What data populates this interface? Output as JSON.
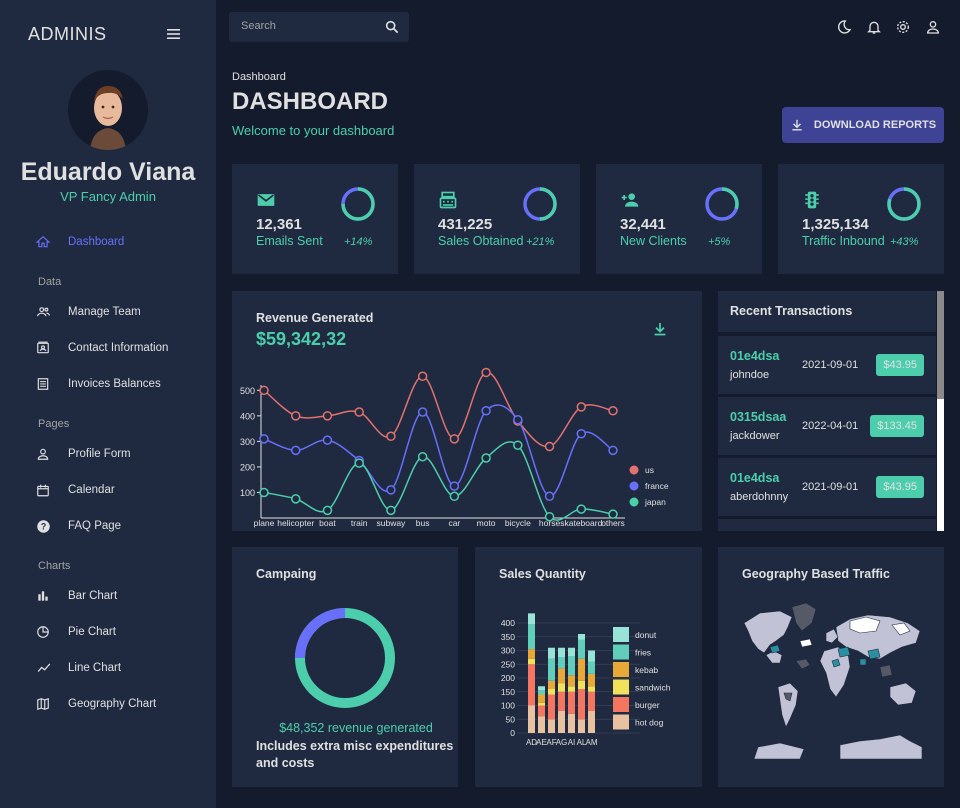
{
  "sidebar": {
    "brand": "ADMINIS",
    "user_name": "Eduardo Viana",
    "user_role": "VP Fancy Admin",
    "items": [
      {
        "label": "Dashboard",
        "icon": "home-icon"
      },
      {
        "label": "Manage Team",
        "icon": "team-icon"
      },
      {
        "label": "Contact Information",
        "icon": "contacts-icon"
      },
      {
        "label": "Invoices Balances",
        "icon": "receipt-icon"
      },
      {
        "label": "Profile Form",
        "icon": "person-icon"
      },
      {
        "label": "Calendar",
        "icon": "calendar-icon"
      },
      {
        "label": "FAQ Page",
        "icon": "help-icon"
      },
      {
        "label": "Bar Chart",
        "icon": "bar-chart-icon"
      },
      {
        "label": "Pie Chart",
        "icon": "pie-chart-icon"
      },
      {
        "label": "Line Chart",
        "icon": "line-chart-icon"
      },
      {
        "label": "Geography Chart",
        "icon": "map-icon"
      }
    ],
    "sections": [
      "Data",
      "Pages",
      "Charts"
    ]
  },
  "topbar": {
    "search_placeholder": "Search",
    "icons": [
      "dark-mode-icon",
      "notifications-icon",
      "settings-icon",
      "person-icon"
    ]
  },
  "header": {
    "breadcrumb": "Dashboard",
    "title": "DASHBOARD",
    "subtitle": "Welcome to your dashboard",
    "download_label": "DOWNLOAD REPORTS"
  },
  "stats": [
    {
      "value": "12,361",
      "label": "Emails Sent",
      "pct": "+14%",
      "progress": 0.75,
      "icon": "email-icon"
    },
    {
      "value": "431,225",
      "label": "Sales Obtained",
      "pct": "+21%",
      "progress": 0.5,
      "icon": "point-of-sale-icon"
    },
    {
      "value": "32,441",
      "label": "New Clients",
      "pct": "+5%",
      "progress": 0.3,
      "icon": "person-add-icon"
    },
    {
      "value": "1,325,134",
      "label": "Traffic Inbound",
      "pct": "+43%",
      "progress": 0.8,
      "icon": "traffic-icon"
    }
  ],
  "revenue": {
    "title": "Revenue Generated",
    "value": "$59,342,32"
  },
  "transactions": {
    "title": "Recent Transactions",
    "items": [
      {
        "txId": "01e4dsa",
        "user": "johndoe",
        "date": "2021-09-01",
        "cost": "$43.95"
      },
      {
        "txId": "0315dsaa",
        "user": "jackdower",
        "date": "2022-04-01",
        "cost": "$133.45"
      },
      {
        "txId": "01e4dsa",
        "user": "aberdohnny",
        "date": "2021-09-01",
        "cost": "$43.95"
      }
    ]
  },
  "campaign": {
    "title": "Campaing",
    "revenue_text": "$48,352 revenue generated",
    "note": "Includes extra misc expenditures and costs",
    "progress": 0.25
  },
  "sales": {
    "title": "Sales Quantity"
  },
  "geo": {
    "title": "Geography Based Traffic"
  },
  "colors": {
    "bg": "#141b2d",
    "panel": "#1f2a40",
    "accent_green": "#4cceac",
    "accent_blue": "#6870fa",
    "button": "#3e4396",
    "text": "#e0e0e0"
  },
  "chart_data": [
    {
      "type": "line",
      "categories": [
        "plane",
        "helicopter",
        "boat",
        "train",
        "subway",
        "bus",
        "car",
        "moto",
        "bicycle",
        "horse",
        "skateboard",
        "others"
      ],
      "yticks": [
        100,
        200,
        300,
        400,
        500
      ],
      "series": [
        {
          "name": "us",
          "color": "#e2726e",
          "values": [
            500,
            400,
            400,
            415,
            320,
            555,
            310,
            570,
            380,
            280,
            435,
            420
          ]
        },
        {
          "name": "france",
          "color": "#6870fa",
          "values": [
            310,
            265,
            305,
            225,
            110,
            415,
            125,
            420,
            385,
            85,
            330,
            265
          ]
        },
        {
          "name": "japan",
          "color": "#4cceac",
          "values": [
            100,
            75,
            30,
            215,
            30,
            240,
            85,
            235,
            285,
            5,
            35,
            15
          ]
        }
      ],
      "legend": "right"
    },
    {
      "type": "bar",
      "categories": [
        "AD",
        "AE",
        "AF",
        "AG",
        "AI",
        "AL",
        "AM"
      ],
      "yticks": [
        0,
        50,
        100,
        150,
        200,
        250,
        300,
        350,
        400
      ],
      "series": [
        {
          "name": "hot dog",
          "color": "#e8c1a0",
          "values": [
            100,
            60,
            50,
            80,
            70,
            50,
            80
          ]
        },
        {
          "name": "burger",
          "color": "#f47560",
          "values": [
            150,
            40,
            90,
            70,
            80,
            110,
            70
          ]
        },
        {
          "name": "sandwich",
          "color": "#f1e15b",
          "values": [
            20,
            10,
            20,
            30,
            20,
            30,
            20
          ]
        },
        {
          "name": "kebab",
          "color": "#e8a838",
          "values": [
            35,
            30,
            30,
            55,
            40,
            80,
            45
          ]
        },
        {
          "name": "fries",
          "color": "#61cdbb",
          "values": [
            90,
            15,
            80,
            40,
            70,
            70,
            45
          ]
        },
        {
          "name": "donut",
          "color": "#97e3d5",
          "values": [
            40,
            15,
            40,
            35,
            30,
            20,
            40
          ]
        }
      ],
      "legend": "right"
    }
  ]
}
